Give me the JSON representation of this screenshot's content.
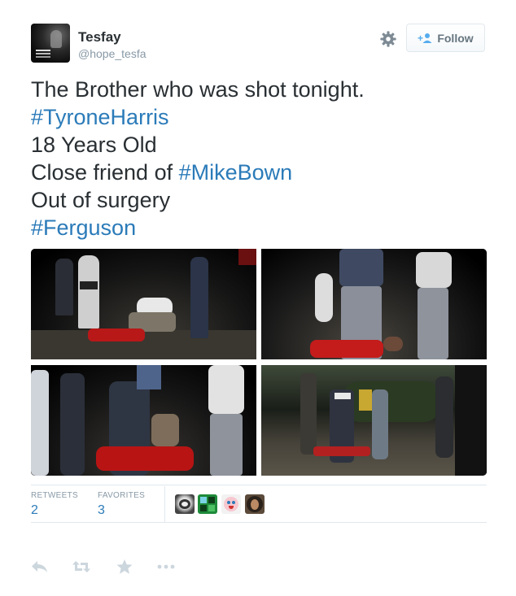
{
  "author": {
    "name": "Tesfay",
    "handle": "@hope_tesfa",
    "avatar_icon": "profile-avatar"
  },
  "header": {
    "settings_icon": "gear-icon",
    "follow_label": "Follow",
    "follow_icon": "add-user-icon"
  },
  "tweet": {
    "lines": [
      {
        "text": "The Brother who was shot tonight."
      },
      {
        "text": "#TyroneHarris",
        "hashtag": true
      },
      {
        "text": "18 Years Old"
      },
      {
        "prefix": "Close friend of ",
        "hashtag_text": "#MikeBown"
      },
      {
        "text": "Out of surgery"
      },
      {
        "text": "#Ferguson",
        "hashtag": true
      }
    ]
  },
  "media": {
    "photos": [
      "photo-1",
      "photo-2",
      "photo-3",
      "photo-4"
    ]
  },
  "stats": {
    "retweets_label": "RETWEETS",
    "retweets_value": "2",
    "favorites_label": "FAVORITES",
    "favorites_value": "3",
    "favoriter_avatars": [
      "avatar-1",
      "avatar-2",
      "avatar-3",
      "avatar-4"
    ]
  },
  "actions": [
    "reply-icon",
    "retweet-icon",
    "favorite-icon",
    "more-icon"
  ],
  "colors": {
    "link": "#2b7bb9",
    "text": "#292f33",
    "muted": "#8899a6",
    "action": "#ccd6dd",
    "border": "#e1e8ed"
  }
}
